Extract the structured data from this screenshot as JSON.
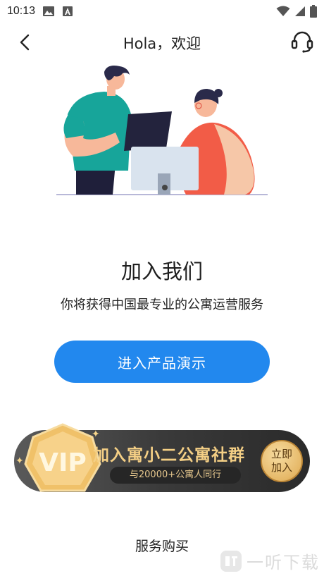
{
  "status_bar": {
    "time": "10:13"
  },
  "header": {
    "title": "Hola，欢迎"
  },
  "join": {
    "title": "加入我们",
    "subtitle": "你将获得中国最专业的公寓运营服务",
    "demo_button": "进入产品演示"
  },
  "vip_banner": {
    "badge_text": "VIP",
    "title": "加入寓小二公寓社群",
    "subtitle": "与20000+公寓人同行",
    "join_line1": "立即",
    "join_line2": "加入"
  },
  "footer": {
    "purchase_link": "服务购买"
  },
  "watermark": {
    "text": "一听下载"
  },
  "icons": {
    "back": "chevron-left-icon",
    "support": "headset-icon"
  },
  "colors": {
    "primary": "#2288ee",
    "vip_gold": "#f4cf85",
    "banner_dark": "#333333"
  }
}
